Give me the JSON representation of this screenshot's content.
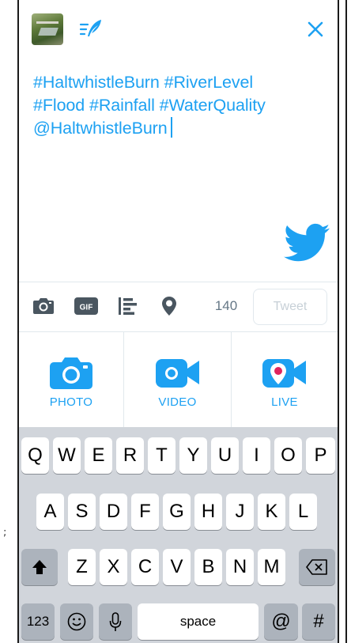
{
  "compose": {
    "tweet_lines": [
      "#HaltwhistleBurn #RiverLevel",
      "#Flood #Rainfall #WaterQuality",
      "@HaltwhistleBurn"
    ],
    "accent_color": "#1da1f2"
  },
  "toolbar": {
    "char_count": "140",
    "tweet_label": "Tweet"
  },
  "media": {
    "photo_label": "PHOTO",
    "video_label": "VIDEO",
    "live_label": "LIVE"
  },
  "keyboard": {
    "row1": [
      "Q",
      "W",
      "E",
      "R",
      "T",
      "Y",
      "U",
      "I",
      "O",
      "P"
    ],
    "row2": [
      "A",
      "S",
      "D",
      "F",
      "G",
      "H",
      "J",
      "K",
      "L"
    ],
    "row3": [
      "Z",
      "X",
      "C",
      "V",
      "B",
      "N",
      "M"
    ],
    "numbers_label": "123",
    "space_label": "space",
    "at_label": "@",
    "hash_label": "#"
  },
  "stray_char": ";"
}
